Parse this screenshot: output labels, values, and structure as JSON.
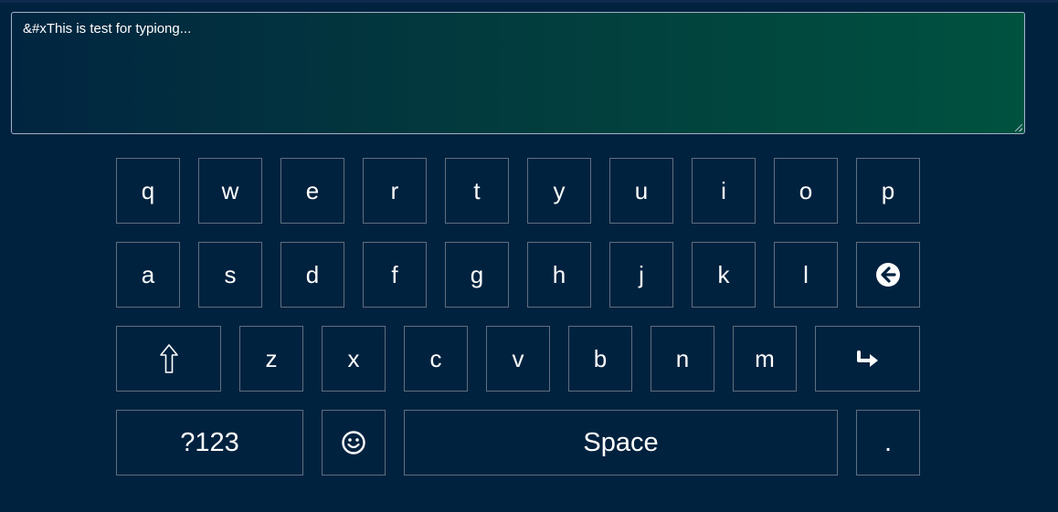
{
  "editor": {
    "value": "&#xThis is test for typiong..."
  },
  "keyboard": {
    "row1": [
      "q",
      "w",
      "e",
      "r",
      "t",
      "y",
      "u",
      "i",
      "o",
      "p"
    ],
    "row2": [
      "a",
      "s",
      "d",
      "f",
      "g",
      "h",
      "j",
      "k",
      "l"
    ],
    "row3": [
      "z",
      "x",
      "c",
      "v",
      "b",
      "n",
      "m"
    ],
    "backspace_icon": "arrow-left-circle-icon",
    "shift_icon": "shift-arrow-up-icon",
    "enter_icon": "enter-arrow-icon",
    "emoji_icon": "smiley-icon",
    "symbols_label": "?123",
    "space_label": "Space",
    "period_label": "."
  },
  "colors": {
    "background": "#01223f",
    "key_border": "#5d6f7f",
    "text": "#ffffff",
    "editor_gradient_start": "#012540",
    "editor_gradient_end": "#00523f"
  }
}
